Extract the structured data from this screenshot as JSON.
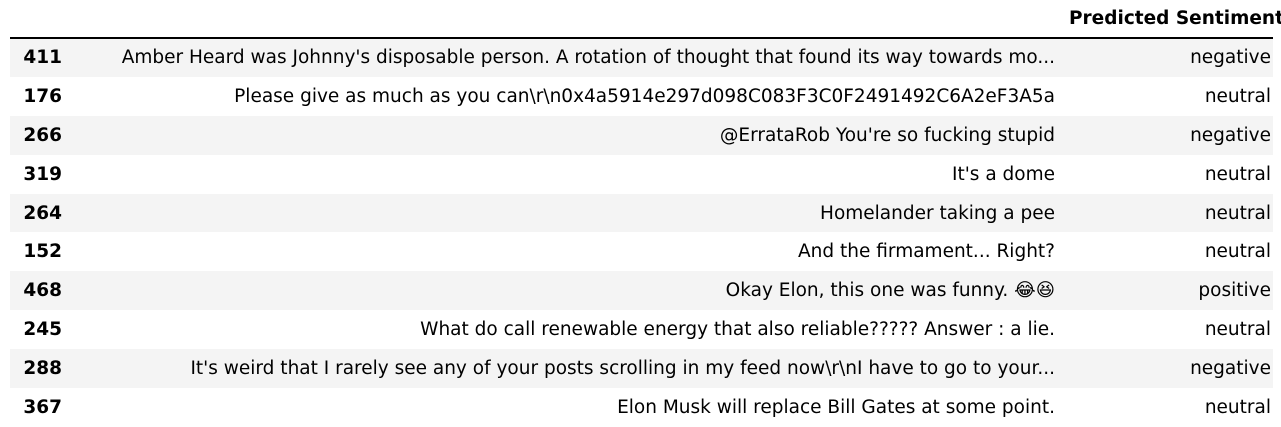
{
  "table": {
    "columns": {
      "index": "",
      "text": "",
      "sentiment": "Predicted Sentiment"
    },
    "rows": [
      {
        "index": "411",
        "text": "Amber Heard was Johnny's disposable person. A rotation of thought that found its way towards mo...",
        "sentiment": "negative"
      },
      {
        "index": "176",
        "text": "Please give as much as you can\\r\\n0x4a5914e297d098C083F3C0F2491492C6A2eF3A5a",
        "sentiment": "neutral"
      },
      {
        "index": "266",
        "text": "@ErrataRob You're so fucking stupid",
        "sentiment": "negative"
      },
      {
        "index": "319",
        "text": "It's a dome",
        "sentiment": "neutral"
      },
      {
        "index": "264",
        "text": "Homelander taking a pee",
        "sentiment": "neutral"
      },
      {
        "index": "152",
        "text": "And the firmament... Right?",
        "sentiment": "neutral"
      },
      {
        "index": "468",
        "text": "Okay Elon, this one was funny. 😂😆",
        "sentiment": "positive"
      },
      {
        "index": "245",
        "text": "What do call renewable energy that also reliable????? Answer : a lie.",
        "sentiment": "neutral"
      },
      {
        "index": "288",
        "text": "It's weird that I rarely see any of your posts scrolling in my feed now\\r\\nI have to go to your...",
        "sentiment": "negative"
      },
      {
        "index": "367",
        "text": "Elon Musk will replace Bill Gates at some point.",
        "sentiment": "neutral"
      }
    ]
  }
}
